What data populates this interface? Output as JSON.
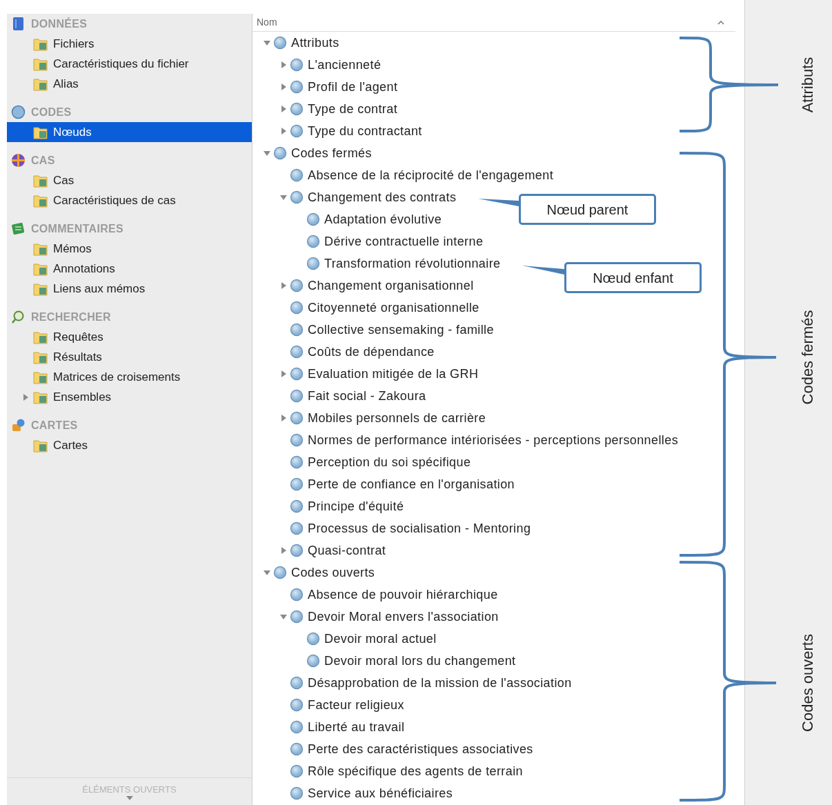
{
  "sidebar": {
    "sections": [
      {
        "title": "DONNÉES",
        "items": [
          {
            "label": "Fichiers",
            "selected": false
          },
          {
            "label": "Caractéristiques du fichier",
            "selected": false
          },
          {
            "label": "Alias",
            "selected": false
          }
        ]
      },
      {
        "title": "CODES",
        "items": [
          {
            "label": "Nœuds",
            "selected": true
          }
        ]
      },
      {
        "title": "CAS",
        "items": [
          {
            "label": "Cas",
            "selected": false
          },
          {
            "label": "Caractéristiques de cas",
            "selected": false
          }
        ]
      },
      {
        "title": "COMMENTAIRES",
        "items": [
          {
            "label": "Mémos",
            "selected": false
          },
          {
            "label": "Annotations",
            "selected": false
          },
          {
            "label": "Liens aux mémos",
            "selected": false
          }
        ]
      },
      {
        "title": "RECHERCHER",
        "items": [
          {
            "label": "Requêtes",
            "selected": false
          },
          {
            "label": "Résultats",
            "selected": false
          },
          {
            "label": "Matrices de croisements",
            "selected": false
          },
          {
            "label": "Ensembles",
            "selected": false,
            "expanded": false
          }
        ]
      },
      {
        "title": "CARTES",
        "items": [
          {
            "label": "Cartes",
            "selected": false
          }
        ]
      }
    ],
    "footer": "ÉLÉMENTS OUVERTS"
  },
  "tree": {
    "column_header": "Nom",
    "nodes": [
      {
        "label": "Attributs",
        "expanded": true,
        "children": [
          {
            "label": "L'ancienneté",
            "expanded": false
          },
          {
            "label": "Profil de l'agent",
            "expanded": false
          },
          {
            "label": "Type de contrat",
            "expanded": false
          },
          {
            "label": "Type du contractant",
            "expanded": false
          }
        ]
      },
      {
        "label": "Codes fermés",
        "expanded": true,
        "children": [
          {
            "label": "Absence de la réciprocité de l'engagement"
          },
          {
            "label": "Changement des contrats",
            "expanded": true,
            "children": [
              {
                "label": "Adaptation évolutive"
              },
              {
                "label": "Dérive contractuelle interne"
              },
              {
                "label": "Transformation révolutionnaire"
              }
            ]
          },
          {
            "label": "Changement organisationnel",
            "expanded": false
          },
          {
            "label": "Citoyenneté organisationnelle"
          },
          {
            "label": "Collective sensemaking - famille"
          },
          {
            "label": "Coûts de dépendance"
          },
          {
            "label": "Evaluation mitigée de la GRH",
            "expanded": false
          },
          {
            "label": "Fait social - Zakoura"
          },
          {
            "label": "Mobiles personnels de carrière",
            "expanded": false
          },
          {
            "label": "Normes de performance intériorisées - perceptions personnelles"
          },
          {
            "label": "Perception du soi spécifique"
          },
          {
            "label": "Perte de confiance en l'organisation"
          },
          {
            "label": "Principe d'équité"
          },
          {
            "label": "Processus de socialisation - Mentoring"
          },
          {
            "label": "Quasi-contrat",
            "expanded": false
          }
        ]
      },
      {
        "label": "Codes ouverts",
        "expanded": true,
        "children": [
          {
            "label": "Absence de pouvoir hiérarchique"
          },
          {
            "label": "Devoir Moral envers l'association",
            "expanded": true,
            "children": [
              {
                "label": "Devoir moral actuel"
              },
              {
                "label": "Devoir moral lors du changement"
              }
            ]
          },
          {
            "label": "Désapprobation de la mission de l'association"
          },
          {
            "label": "Facteur religieux"
          },
          {
            "label": "Liberté au travail"
          },
          {
            "label": "Perte des caractéristiques associatives"
          },
          {
            "label": "Rôle spécifique des agents de terrain"
          },
          {
            "label": "Service aux bénéficiaires"
          }
        ]
      }
    ]
  },
  "annotations": {
    "callouts": [
      {
        "label": "Nœud parent"
      },
      {
        "label": "Nœud enfant"
      }
    ],
    "brackets": [
      {
        "label": "Attributs"
      },
      {
        "label": "Codes fermés"
      },
      {
        "label": "Codes ouverts"
      }
    ]
  }
}
